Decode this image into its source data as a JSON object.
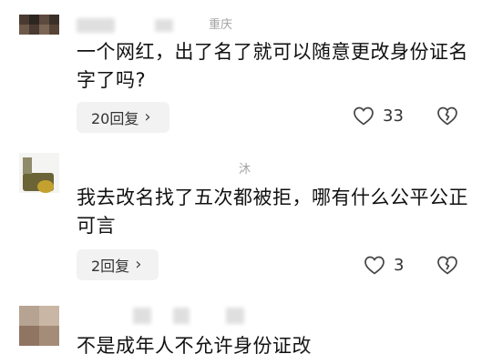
{
  "comments": [
    {
      "location": "重庆",
      "text": "一个网红，出了名了就可以随意更改身份证名字了吗?",
      "reply_label": "20回复",
      "reply_arrow": "›",
      "likes": "33"
    },
    {
      "location": "沐",
      "text": "我去改名找了五次都被拒，哪有什么公平公正可言",
      "reply_label": "2回复",
      "reply_arrow": "›",
      "likes": "3"
    },
    {
      "location": "",
      "text": "不是成年人不允许身份证改",
      "reply_label": "",
      "reply_arrow": "",
      "likes": ""
    }
  ],
  "colors": {
    "text": "#111111",
    "meta": "#a3a3a3",
    "reply_bg": "#f2f2f2"
  }
}
